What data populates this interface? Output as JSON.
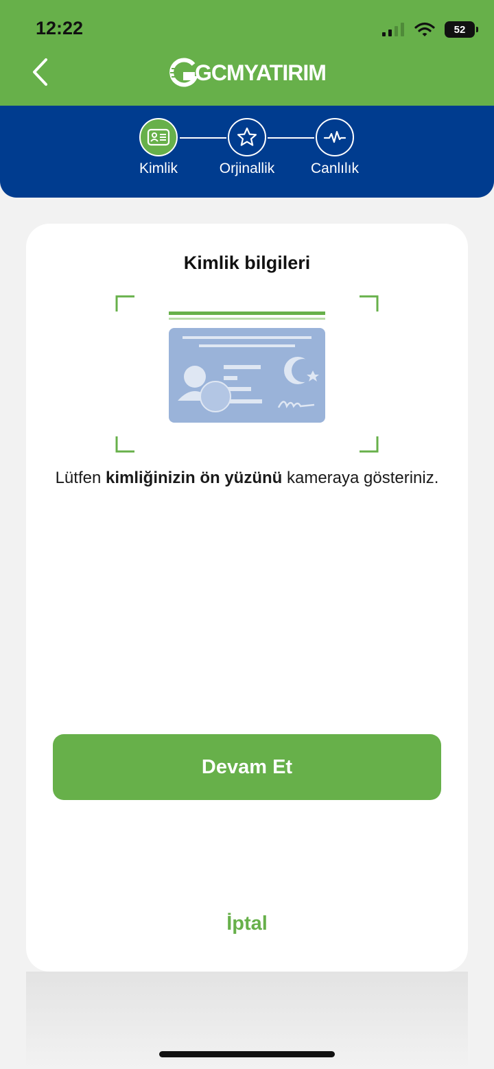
{
  "status_bar": {
    "time": "12:22",
    "battery": "52",
    "icons": [
      "signal-icon",
      "wifi-icon",
      "battery-icon"
    ]
  },
  "header": {
    "logo_text": "GCMYATIRIM",
    "back_icon": "chevron-left-icon"
  },
  "steps": [
    {
      "label": "Kimlik",
      "icon": "id-card-icon",
      "active": true
    },
    {
      "label": "Orjinallik",
      "icon": "star-icon",
      "active": false
    },
    {
      "label": "Canlılık",
      "icon": "heartbeat-icon",
      "active": false
    }
  ],
  "card": {
    "title": "Kimlik bilgileri",
    "instruction_prefix": "Lütfen ",
    "instruction_bold": "kimliğinizin ön yüzünü",
    "instruction_suffix": " kameraya gösteriniz.",
    "continue_label": "Devam Et",
    "cancel_label": "İptal"
  },
  "colors": {
    "brand_green": "#67b04a",
    "brand_blue": "#003c8f",
    "id_card_blue": "#9ab3d9"
  }
}
